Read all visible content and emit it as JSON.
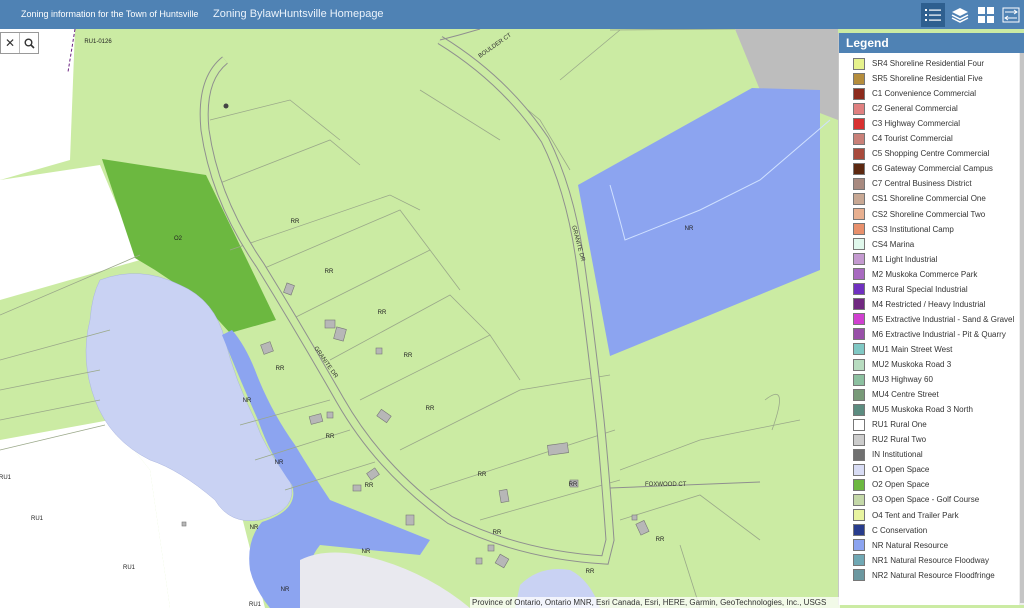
{
  "header": {
    "title": "Zoning information for the Town of Huntsville",
    "links": [
      "Zoning Bylaw",
      "Huntsville Homepage"
    ]
  },
  "toolbar": {
    "buttons": [
      "legend-list",
      "layers",
      "basemap-gallery",
      "swipe"
    ]
  },
  "search": {
    "clear_icon": "✕",
    "search_icon": "search-icon"
  },
  "map": {
    "parcel_labels": {
      "ru1_0126": "RU1-0126",
      "o2": "O2",
      "rr": "RR",
      "nr": "NR",
      "ru1": "RU1"
    },
    "streets": {
      "boulder_ct": "BOULDER CT",
      "granite_dr": "GRANITE DR",
      "foxwood_ct": "FOXWOOD CT"
    },
    "attribution": "Province of Ontario, Ontario MNR, Esri Canada, Esri, HERE, Garmin, GeoTechnologies, Inc., USGS"
  },
  "legend": {
    "title": "Legend",
    "items": [
      {
        "label": "SR4 Shoreline Residential Four",
        "color": "#e6f28c"
      },
      {
        "label": "SR5 Shoreline Residential Five",
        "color": "#b58d3c"
      },
      {
        "label": "C1 Convenience Commercial",
        "color": "#8c2a1c"
      },
      {
        "label": "C2 General Commercial",
        "color": "#e08080"
      },
      {
        "label": "C3 Highway Commercial",
        "color": "#d83030"
      },
      {
        "label": "C4 Tourist Commercial",
        "color": "#c98078"
      },
      {
        "label": "C5 Shopping Centre Commercial",
        "color": "#a84a3c"
      },
      {
        "label": "C6 Gateway Commercial Campus",
        "color": "#5c2810"
      },
      {
        "label": "C7 Central Business District",
        "color": "#a88a80"
      },
      {
        "label": "CS1 Shoreline Commercial One",
        "color": "#c8a894"
      },
      {
        "label": "CS2 Shoreline Commercial Two",
        "color": "#e8b090"
      },
      {
        "label": "CS3 Institutional Camp",
        "color": "#e8906c"
      },
      {
        "label": "CS4 Marina",
        "color": "#e0f8ec"
      },
      {
        "label": "M1 Light Industrial",
        "color": "#c49ad0"
      },
      {
        "label": "M2 Muskoka Commerce Park",
        "color": "#a86ac0"
      },
      {
        "label": "M3 Rural Special Industrial",
        "color": "#7030c0"
      },
      {
        "label": "M4 Restricted / Heavy Industrial",
        "color": "#702880"
      },
      {
        "label": "M5 Extractive Industrial - Sand & Gravel",
        "color": "#d040d0"
      },
      {
        "label": "M6 Extractive Industrial - Pit & Quarry",
        "color": "#9850a8"
      },
      {
        "label": "MU1 Main Street West",
        "color": "#80c8c4"
      },
      {
        "label": "MU2 Muskoka Road 3",
        "color": "#b8dcc0"
      },
      {
        "label": "MU3 Highway 60",
        "color": "#8cc0a0"
      },
      {
        "label": "MU4 Centre Street",
        "color": "#789a78"
      },
      {
        "label": "MU5 Muskoka Road 3 North",
        "color": "#5c8c80"
      },
      {
        "label": "RU1 Rural One",
        "color": "#ffffff"
      },
      {
        "label": "RU2 Rural Two",
        "color": "#cccccc"
      },
      {
        "label": "IN Institutional",
        "color": "#707070"
      },
      {
        "label": "O1 Open Space",
        "color": "#d8dcf4"
      },
      {
        "label": "O2 Open Space",
        "color": "#6cb840"
      },
      {
        "label": "O3 Open Space - Golf Course",
        "color": "#c4d8a8"
      },
      {
        "label": "O4 Tent and Trailer Park",
        "color": "#e8f4a0"
      },
      {
        "label": "C Conservation",
        "color": "#283c8c"
      },
      {
        "label": "NR Natural Resource",
        "color": "#8ca4f0"
      },
      {
        "label": "NR1 Natural Resource Floodway",
        "color": "#70a8b4"
      },
      {
        "label": "NR2 Natural Resource Floodfringe",
        "color": "#6c98a0"
      }
    ]
  }
}
